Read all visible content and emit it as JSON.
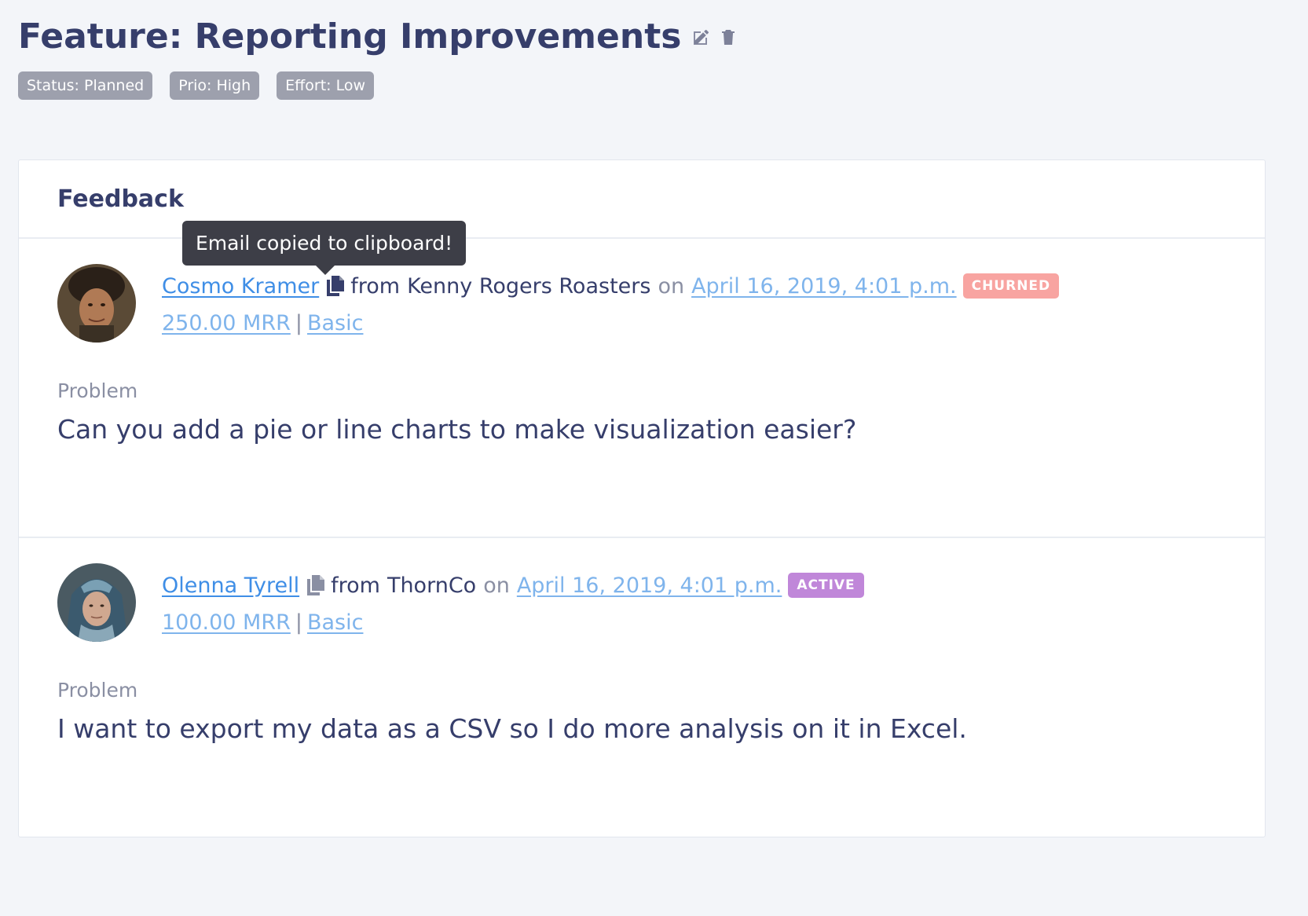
{
  "page": {
    "title": "Feature: Reporting Improvements",
    "tags": [
      "Status: Planned",
      "Prio: High",
      "Effort: Low"
    ]
  },
  "feedback_card": {
    "title": "Feedback",
    "tooltip": "Email copied to clipboard!",
    "items": [
      {
        "name": "Cosmo Kramer",
        "from_label": "from",
        "company": "Kenny Rogers Roasters",
        "on_label": "on",
        "date": "April 16, 2019, 4:01 p.m.",
        "status": "CHURNED",
        "status_color": "#f8a4a1",
        "mrr": "250.00 MRR",
        "separator": "|",
        "plan": "Basic",
        "problem_label": "Problem",
        "problem_text": "Can you add a pie or line charts to make visualization easier?"
      },
      {
        "name": "Olenna Tyrell",
        "from_label": "from",
        "company": "ThornCo",
        "on_label": "on",
        "date": "April 16, 2019, 4:01 p.m.",
        "status": "ACTIVE",
        "status_color": "#c087d9",
        "mrr": "100.00 MRR",
        "separator": "|",
        "plan": "Basic",
        "problem_label": "Problem",
        "problem_text": "I want to export my data as a CSV so I do more analysis on it in Excel."
      }
    ]
  },
  "icons": {
    "edit": "edit-icon",
    "delete": "trash-icon",
    "copy": "copy-icon"
  },
  "colors": {
    "link": "#3f8ee6",
    "link_light": "#7fb4ec",
    "text": "#363e6b",
    "tag_bg": "#9da0ad",
    "background": "#f3f5f9"
  }
}
